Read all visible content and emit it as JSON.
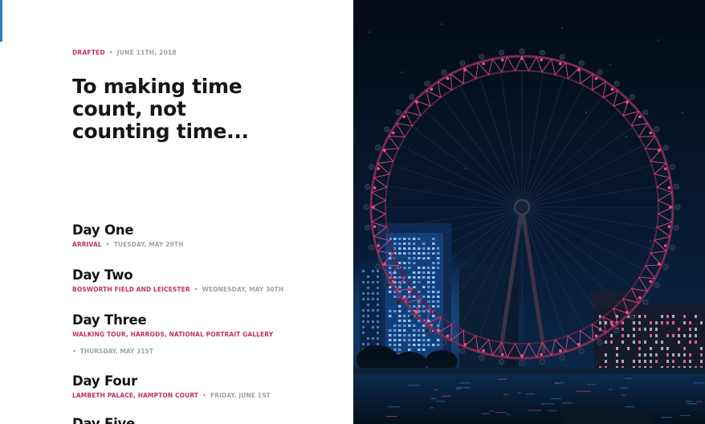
{
  "post": {
    "status": "DRAFTED",
    "date": "JUNE 11TH, 2018",
    "title": "To making time count, not counting time..."
  },
  "days": [
    {
      "title": "Day One",
      "place": "ARRIVAL",
      "date": "TUESDAY, MAY 29TH"
    },
    {
      "title": "Day Two",
      "place": "BOSWORTH FIELD AND LEICESTER",
      "date": "WEDNESDAY, MAY 30TH"
    },
    {
      "title": "Day Three",
      "place": "WALKING TOUR, HARRODS, NATIONAL PORTRAIT GALLERY",
      "date": "THURSDAY, MAY 31ST"
    },
    {
      "title": "Day Four",
      "place": "LAMBETH PALACE, HAMPTON COURT",
      "date": "FRIDAY, JUNE 1ST"
    },
    {
      "title": "Day Five"
    }
  ],
  "hero_image": {
    "subject": "London Eye ferris wheel at night",
    "colors": {
      "sky": "#04101e",
      "wheel_lights": "#ff4f86",
      "city_glow": "#3b8ee0"
    }
  }
}
